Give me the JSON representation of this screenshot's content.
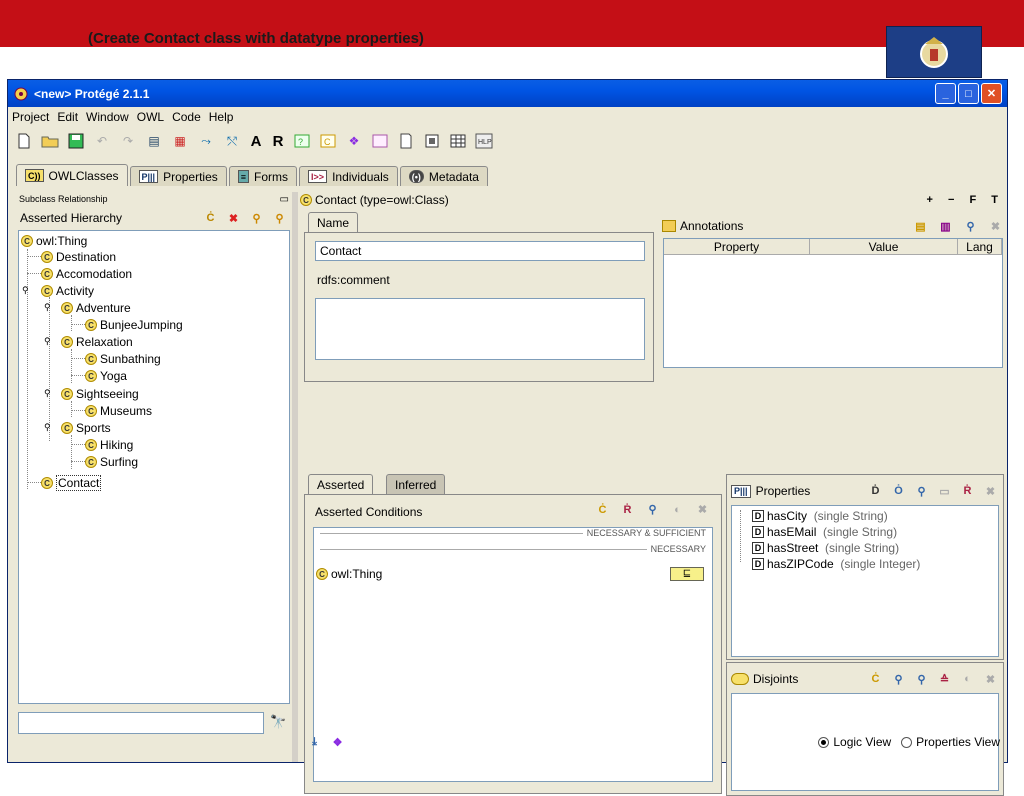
{
  "slide": {
    "title": "(Create Contact class with datatype properties)"
  },
  "window": {
    "title": "<new>  Protégé 2.1.1"
  },
  "menu": [
    "Project",
    "Edit",
    "Window",
    "OWL",
    "Code",
    "Help"
  ],
  "toolbar": {
    "a_label": "A",
    "r_label": "R"
  },
  "tabs": [
    {
      "label": "OWLClasses",
      "icon": "C))"
    },
    {
      "label": "Properties",
      "icon": "P|||"
    },
    {
      "label": "Forms",
      "icon": "≡"
    },
    {
      "label": "Individuals",
      "icon": "I>>"
    },
    {
      "label": "Metadata",
      "icon": "(•)"
    }
  ],
  "left": {
    "header": "Subclass Relationship",
    "title": "Asserted Hierarchy",
    "tree": [
      {
        "label": "owl:Thing"
      },
      {
        "label": "Destination"
      },
      {
        "label": "Accomodation"
      },
      {
        "label": "Activity"
      },
      {
        "label": "Adventure"
      },
      {
        "label": "BunjeeJumping"
      },
      {
        "label": "Relaxation"
      },
      {
        "label": "Sunbathing"
      },
      {
        "label": "Yoga"
      },
      {
        "label": "Sightseeing"
      },
      {
        "label": "Museums"
      },
      {
        "label": "Sports"
      },
      {
        "label": "Hiking"
      },
      {
        "label": "Surfing"
      },
      {
        "label": "Contact"
      }
    ],
    "search_value": ""
  },
  "right": {
    "header": "Contact   (type=owl:Class)",
    "header_controls": "+ − F T",
    "name_tab": "Name",
    "name_value": "Contact",
    "comment_label": "rdfs:comment",
    "comment_value": "",
    "annotations": {
      "title": "Annotations",
      "columns": [
        "Property",
        "Value",
        "Lang"
      ]
    },
    "cond_tabs": [
      "Asserted",
      "Inferred"
    ],
    "conditions": {
      "title": "Asserted Conditions",
      "nec_suff": "NECESSARY & SUFFICIENT",
      "nec": "NECESSARY",
      "rows": [
        {
          "label": "owl:Thing",
          "badge": "⊑"
        }
      ]
    },
    "properties": {
      "title": "Properties",
      "items": [
        {
          "name": "hasCity",
          "type": "(single String)"
        },
        {
          "name": "hasEMail",
          "type": "(single String)"
        },
        {
          "name": "hasStreet",
          "type": "(single String)"
        },
        {
          "name": "hasZIPCode",
          "type": "(single Integer)"
        }
      ]
    },
    "disjoints": {
      "title": "Disjoints"
    },
    "views": {
      "logic": "Logic View",
      "properties": "Properties View",
      "selected": "logic"
    }
  },
  "colors": {
    "accent_red": "#c40f16",
    "titlebar_blue": "#0054e3"
  }
}
